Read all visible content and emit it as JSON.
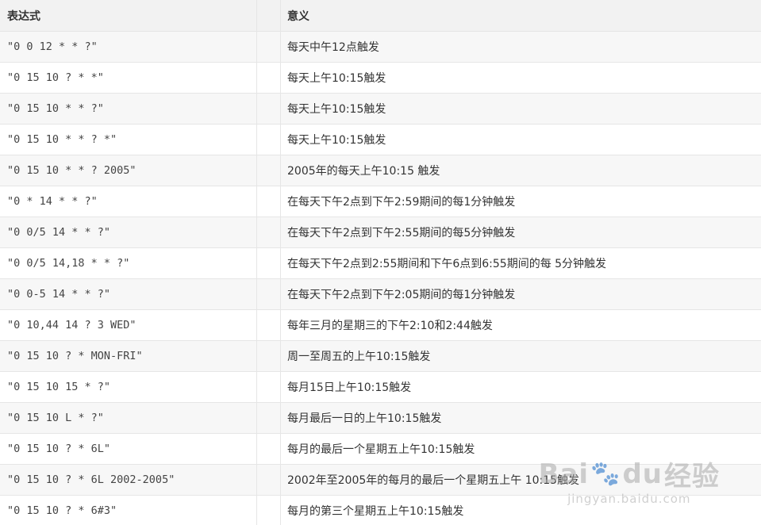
{
  "table": {
    "headers": [
      "表达式",
      "意义"
    ],
    "rows": [
      {
        "expr": "\"0 0 12 * * ?\"",
        "meaning": "每天中午12点触发"
      },
      {
        "expr": "\"0 15 10 ? * *\"",
        "meaning": "每天上午10:15触发"
      },
      {
        "expr": "\"0 15 10 * * ?\"",
        "meaning": "每天上午10:15触发"
      },
      {
        "expr": "\"0 15 10 * * ? *\"",
        "meaning": "每天上午10:15触发"
      },
      {
        "expr": "\"0 15 10 * * ? 2005\"",
        "meaning": "2005年的每天上午10:15 触发"
      },
      {
        "expr": "\"0 * 14 * * ?\"",
        "meaning": "在每天下午2点到下午2:59期间的每1分钟触发"
      },
      {
        "expr": "\"0 0/5 14 * * ?\"",
        "meaning": "在每天下午2点到下午2:55期间的每5分钟触发"
      },
      {
        "expr": "\"0 0/5 14,18 * * ?\"",
        "meaning": "在每天下午2点到2:55期间和下午6点到6:55期间的每 5分钟触发"
      },
      {
        "expr": "\"0 0-5 14 * * ?\"",
        "meaning": "在每天下午2点到下午2:05期间的每1分钟触发"
      },
      {
        "expr": "\"0 10,44 14 ? 3 WED\"",
        "meaning": "每年三月的星期三的下午2:10和2:44触发"
      },
      {
        "expr": "\"0 15 10 ? * MON-FRI\"",
        "meaning": "周一至周五的上午10:15触发"
      },
      {
        "expr": "\"0 15 10 15 * ?\"",
        "meaning": "每月15日上午10:15触发"
      },
      {
        "expr": "\"0 15 10 L * ?\"",
        "meaning": "每月最后一日的上午10:15触发"
      },
      {
        "expr": "\"0 15 10 ? * 6L\"",
        "meaning": "每月的最后一个星期五上午10:15触发"
      },
      {
        "expr": "\"0 15 10 ? * 6L 2002-2005\"",
        "meaning": "2002年至2005年的每月的最后一个星期五上午 10:15触发"
      },
      {
        "expr": "\"0 15 10 ? * 6#3\"",
        "meaning": "每月的第三个星期五上午10:15触发"
      }
    ]
  },
  "watermark": {
    "brand_a": "Bai",
    "brand_b": "du",
    "brand_c": "经验",
    "sub": "jingyan.baidu.com"
  }
}
